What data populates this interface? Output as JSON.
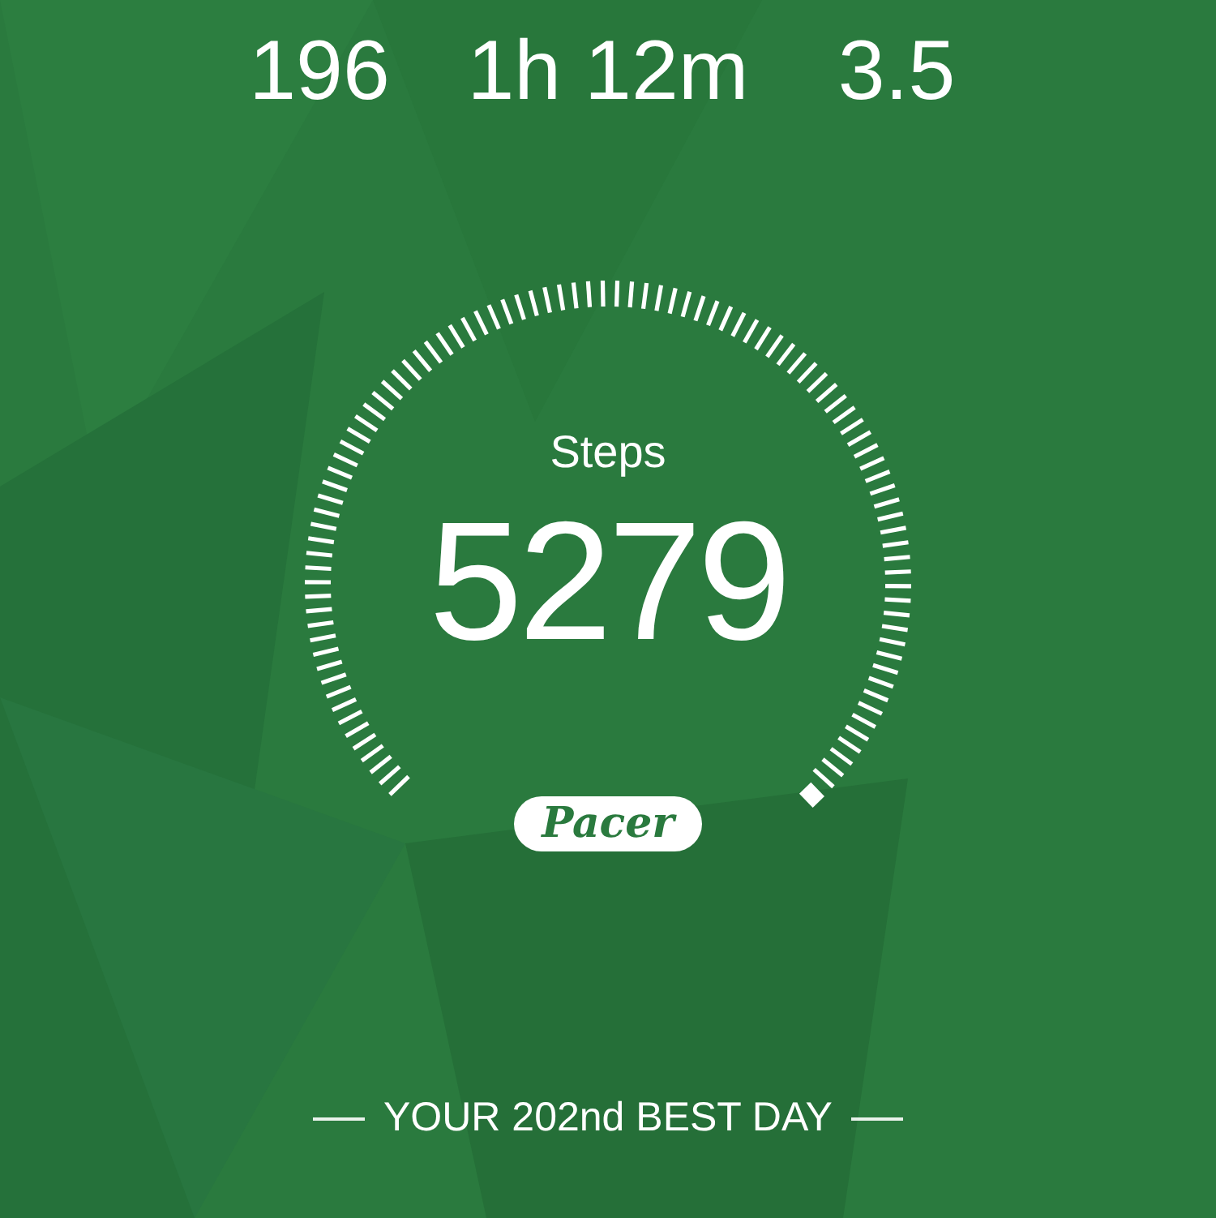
{
  "stats": [
    {
      "value": "196"
    },
    {
      "value": "1h 12m"
    },
    {
      "value": "3.5"
    }
  ],
  "steps": {
    "label": "Steps",
    "value": "5279"
  },
  "logo": "Pacer",
  "footer": {
    "text": "YOUR 202nd BEST DAY"
  }
}
